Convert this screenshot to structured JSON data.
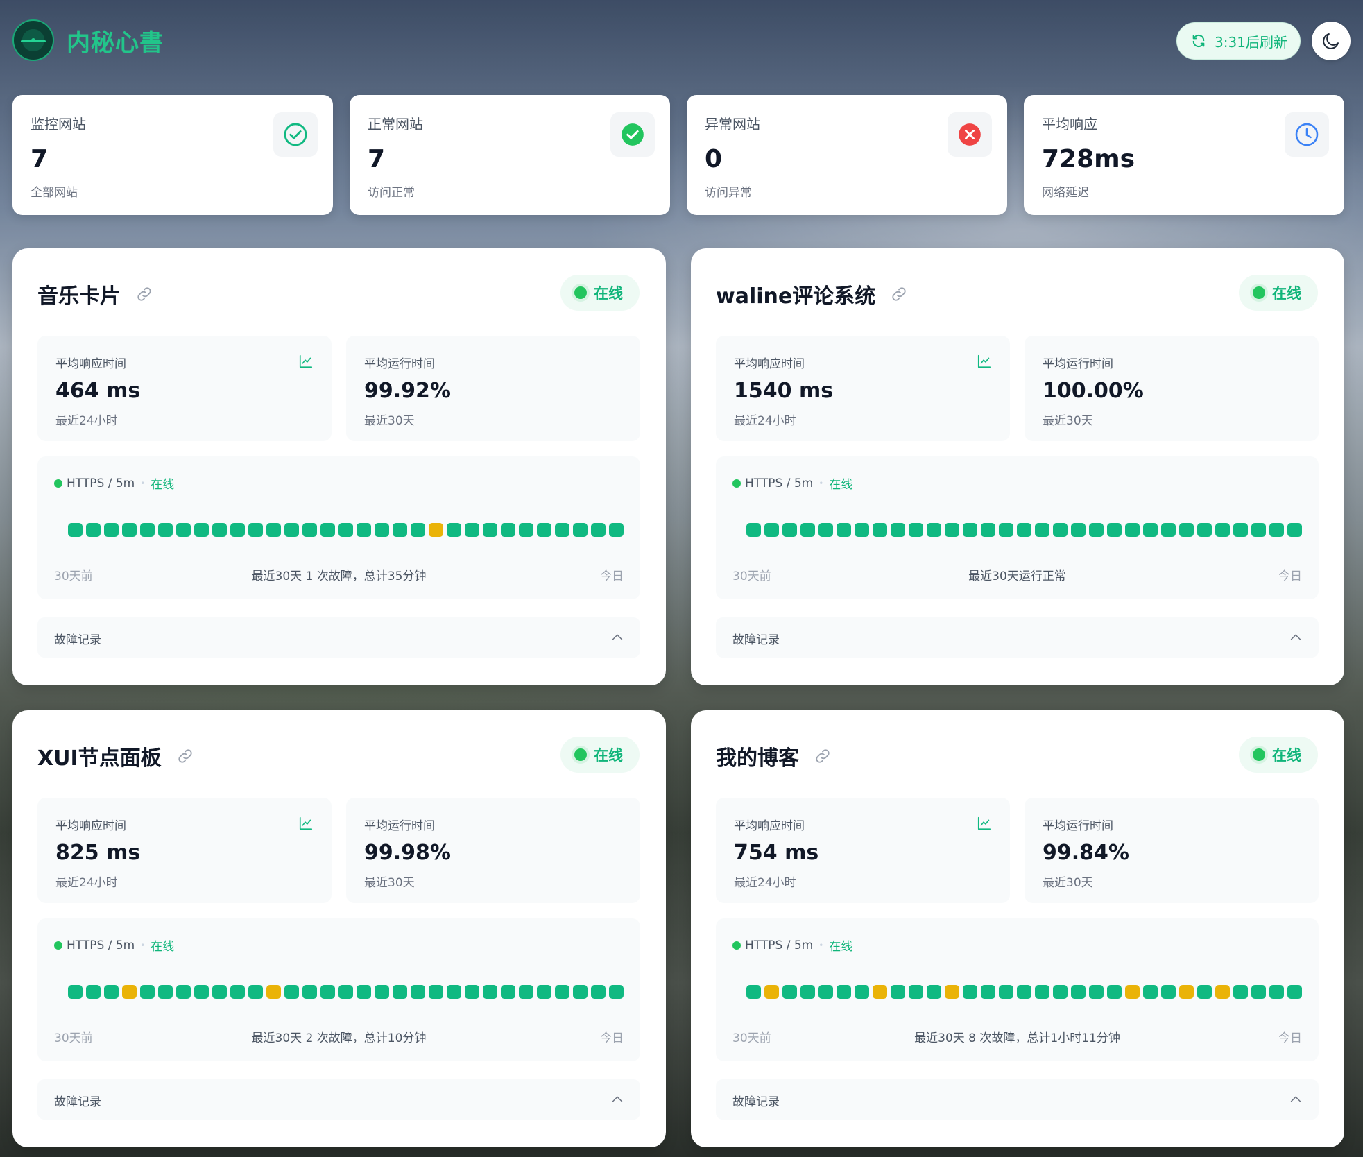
{
  "app": {
    "title": "内秘心書",
    "refresh_label": "3:31后刷新",
    "accent": "#22c58a"
  },
  "stats": [
    {
      "label": "监控网站",
      "value": "7",
      "sub": "全部网站",
      "icon": "check-circle-outline-icon"
    },
    {
      "label": "正常网站",
      "value": "7",
      "sub": "访问正常",
      "icon": "check-circle-filled-icon"
    },
    {
      "label": "异常网站",
      "value": "0",
      "sub": "访问异常",
      "icon": "x-circle-icon"
    },
    {
      "label": "平均响应",
      "value": "728ms",
      "sub": "网络延迟",
      "icon": "clock-icon"
    }
  ],
  "monitors": [
    {
      "name": "音乐卡片",
      "status": "在线",
      "resp_label": "平均响应时间",
      "resp_value": "464 ms",
      "resp_sub": "最近24小时",
      "up_label": "平均运行时间",
      "up_value": "99.92%",
      "up_sub": "最近30天",
      "protocol": "HTTPS / 5m",
      "proto_status": "在线",
      "bars": [
        0,
        0,
        0,
        0,
        0,
        0,
        0,
        0,
        0,
        0,
        0,
        0,
        0,
        0,
        0,
        0,
        0,
        0,
        0,
        0,
        1,
        0,
        0,
        0,
        0,
        0,
        0,
        0,
        0,
        0,
        0
      ],
      "foot_left": "30天前",
      "foot_center": "最近30天 1 次故障，总计35分钟",
      "foot_right": "今日",
      "faults_label": "故障记录"
    },
    {
      "name": "waline评论系统",
      "status": "在线",
      "resp_label": "平均响应时间",
      "resp_value": "1540 ms",
      "resp_sub": "最近24小时",
      "up_label": "平均运行时间",
      "up_value": "100.00%",
      "up_sub": "最近30天",
      "protocol": "HTTPS / 5m",
      "proto_status": "在线",
      "bars": [
        0,
        0,
        0,
        0,
        0,
        0,
        0,
        0,
        0,
        0,
        0,
        0,
        0,
        0,
        0,
        0,
        0,
        0,
        0,
        0,
        0,
        0,
        0,
        0,
        0,
        0,
        0,
        0,
        0,
        0,
        0
      ],
      "foot_left": "30天前",
      "foot_center": "最近30天运行正常",
      "foot_right": "今日",
      "faults_label": "故障记录"
    },
    {
      "name": "XUI节点面板",
      "status": "在线",
      "resp_label": "平均响应时间",
      "resp_value": "825 ms",
      "resp_sub": "最近24小时",
      "up_label": "平均运行时间",
      "up_value": "99.98%",
      "up_sub": "最近30天",
      "protocol": "HTTPS / 5m",
      "proto_status": "在线",
      "bars": [
        0,
        0,
        0,
        1,
        0,
        0,
        0,
        0,
        0,
        0,
        0,
        1,
        0,
        0,
        0,
        0,
        0,
        0,
        0,
        0,
        0,
        0,
        0,
        0,
        0,
        0,
        0,
        0,
        0,
        0,
        0
      ],
      "foot_left": "30天前",
      "foot_center": "最近30天 2 次故障，总计10分钟",
      "foot_right": "今日",
      "faults_label": "故障记录"
    },
    {
      "name": "我的博客",
      "status": "在线",
      "resp_label": "平均响应时间",
      "resp_value": "754 ms",
      "resp_sub": "最近24小时",
      "up_label": "平均运行时间",
      "up_value": "99.84%",
      "up_sub": "最近30天",
      "protocol": "HTTPS / 5m",
      "proto_status": "在线",
      "bars": [
        0,
        1,
        0,
        0,
        0,
        0,
        0,
        1,
        0,
        0,
        0,
        1,
        0,
        0,
        0,
        0,
        0,
        0,
        0,
        0,
        0,
        1,
        0,
        0,
        1,
        0,
        1,
        0,
        0,
        0,
        0
      ],
      "foot_left": "30天前",
      "foot_center": "最近30天 8 次故障，总计1小时11分钟",
      "foot_right": "今日",
      "faults_label": "故障记录"
    }
  ],
  "colors": {
    "ok": "#10b981",
    "warn": "#eab308",
    "error": "#ef4444",
    "info": "#3b82f6"
  }
}
